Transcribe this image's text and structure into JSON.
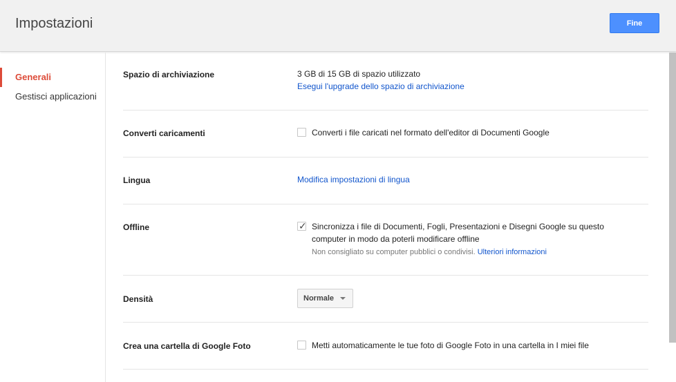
{
  "header": {
    "title": "Impostazioni",
    "done_label": "Fine"
  },
  "sidebar": {
    "items": [
      {
        "label": "Generali",
        "active": true
      },
      {
        "label": "Gestisci applicazioni",
        "active": false
      }
    ]
  },
  "settings": {
    "storage": {
      "label": "Spazio di archiviazione",
      "usage": "3 GB di 15 GB di spazio utilizzato",
      "upgrade_link": "Esegui l'upgrade dello spazio di archiviazione"
    },
    "convert": {
      "label": "Converti caricamenti",
      "checkbox_text": "Converti i file caricati nel formato dell'editor di Documenti Google",
      "checked": false
    },
    "language": {
      "label": "Lingua",
      "link": "Modifica impostazioni di lingua"
    },
    "offline": {
      "label": "Offline",
      "checkbox_text": "Sincronizza i file di Documenti, Fogli, Presentazioni e Disegni Google su questo computer in modo da poterli modificare offline",
      "hint": "Non consigliato su computer pubblici o condivisi.",
      "hint_link": "Ulteriori informazioni",
      "checked": true
    },
    "density": {
      "label": "Densità",
      "selected": "Normale"
    },
    "photos": {
      "label": "Crea una cartella di Google Foto",
      "checkbox_text": "Metti automaticamente le tue foto di Google Foto in una cartella in I miei file",
      "checked": false
    }
  },
  "colors": {
    "accent": "#dd4b39",
    "link": "#1155cc",
    "primary_button": "#4d90fe"
  }
}
